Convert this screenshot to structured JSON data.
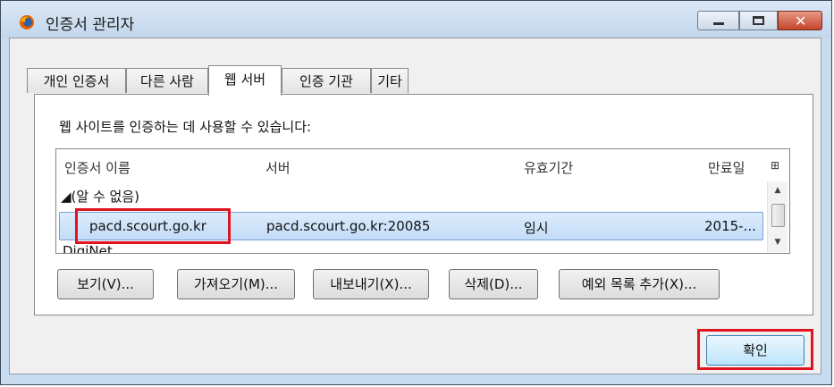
{
  "window": {
    "title": "인증서 관리자"
  },
  "tabs": [
    {
      "label": "개인 인증서",
      "active": false
    },
    {
      "label": "다른 사람",
      "active": false
    },
    {
      "label": "웹 서버",
      "active": true
    },
    {
      "label": "인증 기관",
      "active": false
    },
    {
      "label": "기타",
      "active": false
    }
  ],
  "panel": {
    "description": "웹 사이트를 인증하는 데 사용할 수 있습니다:",
    "columns": [
      "인증서 이름",
      "서버",
      "유효기간",
      "만료일"
    ],
    "group_label": "◢(알 수 없음)",
    "selected_row": {
      "name": "pacd.scourt.go.kr",
      "server": "pacd.scourt.go.kr:20085",
      "lifetime": "임시",
      "expires": "2015-..."
    },
    "partial_row_text": "DigiNet"
  },
  "buttons": {
    "view": "보기(V)...",
    "import": "가져오기(M)...",
    "export": "내보내기(X)...",
    "delete": "삭제(D)...",
    "add_exception": "예외 목록 추가(X)..."
  },
  "ok_label": "확인",
  "colors": {
    "highlight": "#e0141e",
    "selection": "#c2dcf7"
  }
}
